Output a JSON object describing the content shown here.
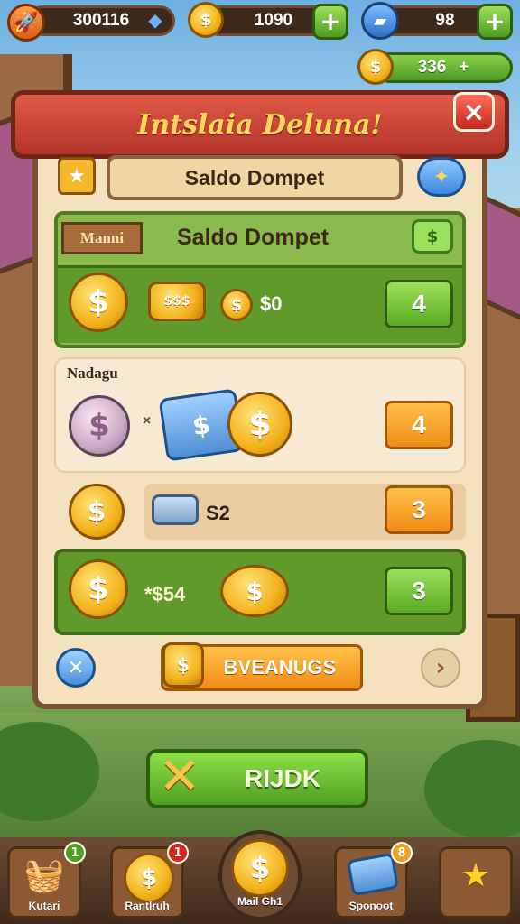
{
  "top_bar": {
    "gems": "300116",
    "coins": "1090",
    "tickets": "98",
    "bonus": "336",
    "plus": "+"
  },
  "dialog": {
    "title": "Intslaia Deluna!",
    "close": "×",
    "header_field": "Saldo Dompet",
    "section_tag": "Manni",
    "section_title": "Saldo Dompet",
    "rows": [
      {
        "text": "$0",
        "value": "4"
      },
      {
        "text": "",
        "value": "4"
      },
      {
        "text": "S2",
        "value": "3"
      },
      {
        "text": "*$54",
        "value": "3"
      }
    ],
    "light_label": "Nadagu",
    "footer_button": "BVEANUGS",
    "main_button": "RIJDK"
  },
  "nav": {
    "items": [
      {
        "label": "Kutari",
        "badge": "1"
      },
      {
        "label": "Rantlruh",
        "badge": "1"
      },
      {
        "label": "Mail Gh1",
        "badge": ""
      },
      {
        "label": "Sponoot",
        "badge": "8"
      },
      {
        "label": "",
        "badge": ""
      }
    ]
  },
  "colors": {
    "panel": "#f3e2bd",
    "banner": "#c53a2e",
    "green": "#5f9a2a",
    "orange": "#f6a42a"
  }
}
